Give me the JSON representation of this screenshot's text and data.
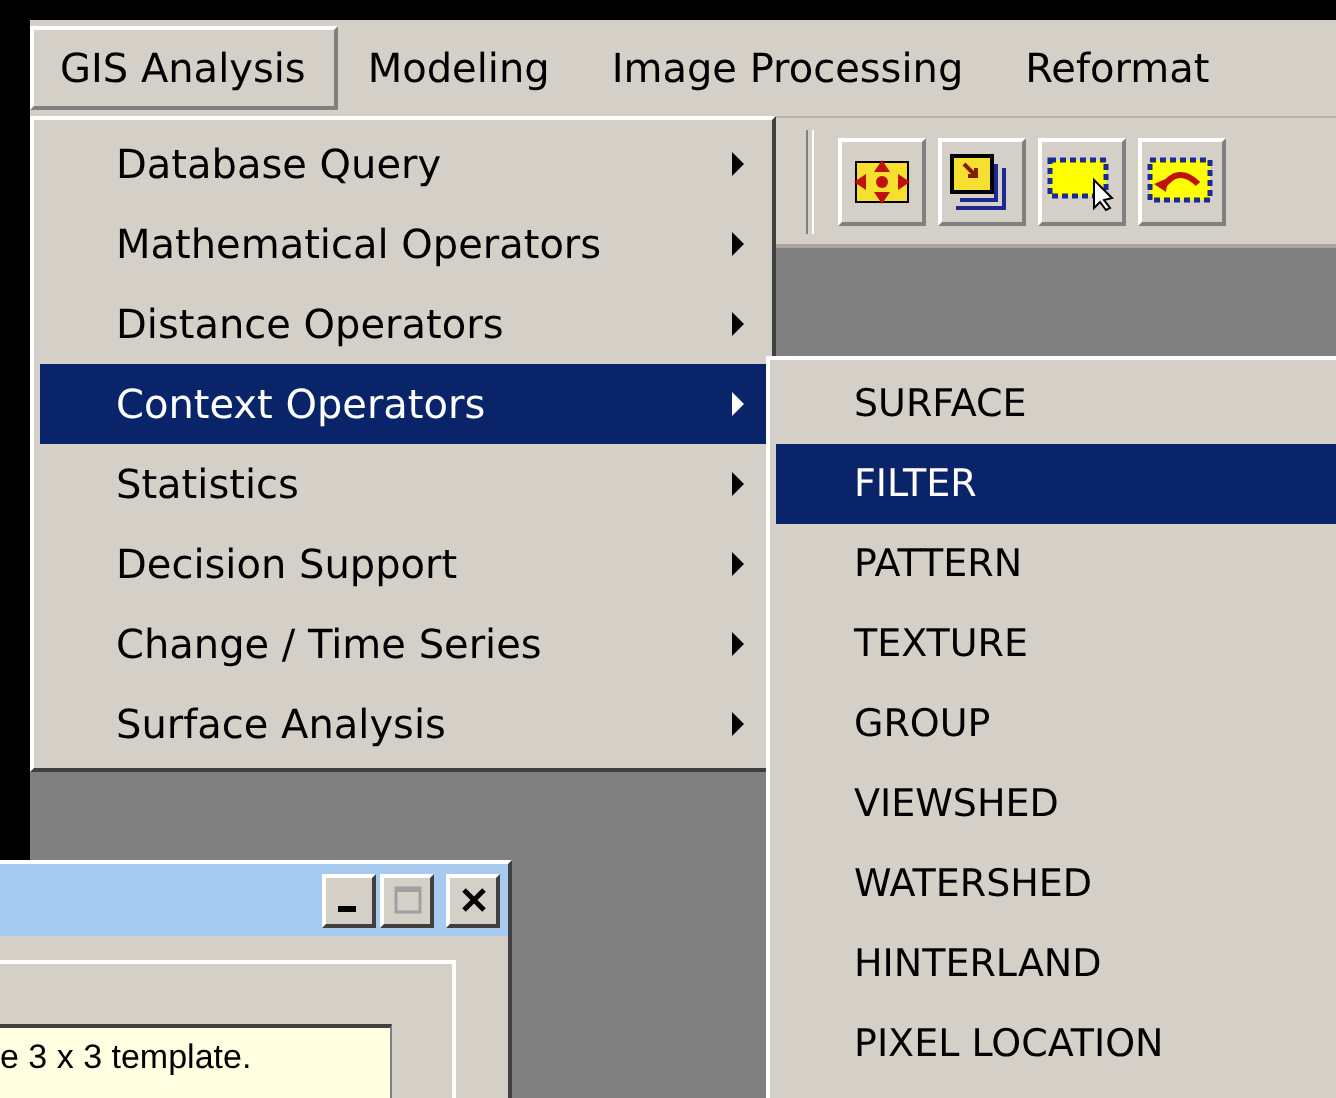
{
  "menubar": [
    {
      "label": "GIS Analysis",
      "selected": true
    },
    {
      "label": "Modeling",
      "selected": false
    },
    {
      "label": "Image Processing",
      "selected": false
    },
    {
      "label": "Reformat",
      "selected": false
    }
  ],
  "toolbar": {
    "buttons": [
      {
        "kind": "expand"
      },
      {
        "kind": "layers"
      },
      {
        "kind": "select"
      },
      {
        "kind": "undo"
      }
    ]
  },
  "menu": {
    "items": [
      {
        "label": "Database Query",
        "selected": false,
        "has_submenu": true
      },
      {
        "label": "Mathematical Operators",
        "selected": false,
        "has_submenu": true
      },
      {
        "label": "Distance Operators",
        "selected": false,
        "has_submenu": true
      },
      {
        "label": "Context Operators",
        "selected": true,
        "has_submenu": true
      },
      {
        "label": "Statistics",
        "selected": false,
        "has_submenu": true
      },
      {
        "label": "Decision Support",
        "selected": false,
        "has_submenu": true
      },
      {
        "label": "Change / Time Series",
        "selected": false,
        "has_submenu": true
      },
      {
        "label": "Surface Analysis",
        "selected": false,
        "has_submenu": true
      }
    ]
  },
  "submenu": {
    "items": [
      {
        "label": "SURFACE",
        "selected": false
      },
      {
        "label": "FILTER",
        "selected": true
      },
      {
        "label": "PATTERN",
        "selected": false
      },
      {
        "label": "TEXTURE",
        "selected": false
      },
      {
        "label": "GROUP",
        "selected": false
      },
      {
        "label": "VIEWSHED",
        "selected": false
      },
      {
        "label": "WATERSHED",
        "selected": false
      },
      {
        "label": "HINTERLAND",
        "selected": false
      },
      {
        "label": "PIXEL LOCATION",
        "selected": false
      }
    ]
  },
  "dialog": {
    "window_buttons": [
      {
        "kind": "minimize",
        "disabled": false
      },
      {
        "kind": "maximize",
        "disabled": true
      },
      {
        "kind": "close",
        "disabled": false
      }
    ],
    "hint": "e 3 x 3 template."
  }
}
